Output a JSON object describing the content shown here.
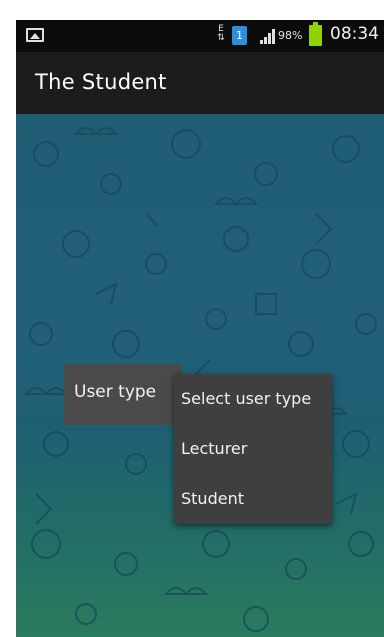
{
  "status_bar": {
    "network_type": "E",
    "sim_slot": "1",
    "battery_percent": "98%",
    "time": "08:34",
    "battery_color": "#8fd400",
    "sim_color": "#2a8fe0"
  },
  "action_bar": {
    "title": "The Student"
  },
  "form": {
    "user_type_label": "User type"
  },
  "dropdown": {
    "options": [
      {
        "label": "Select user type"
      },
      {
        "label": "Lecturer"
      },
      {
        "label": "Student"
      }
    ]
  },
  "colors": {
    "background_teal": "#1f5d74",
    "bar_dark": "#1c1c1c",
    "menu_gray": "#3f3f3f"
  }
}
